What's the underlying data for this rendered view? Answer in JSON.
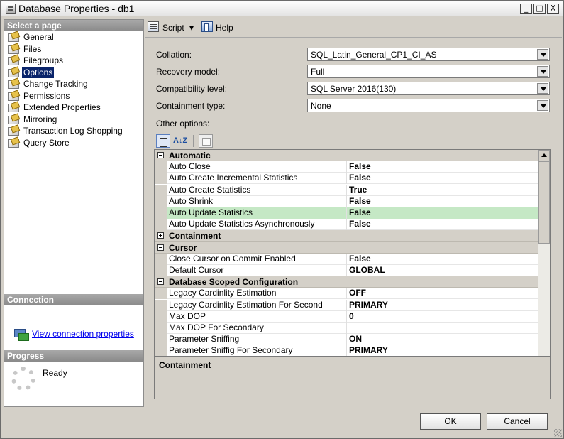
{
  "window": {
    "title": "Database Properties - db1",
    "controls": {
      "minimize": "_",
      "maximize": "□",
      "close": "X"
    }
  },
  "sidebar": {
    "select_page_header": "Select a page",
    "items": [
      {
        "label": "General"
      },
      {
        "label": "Files"
      },
      {
        "label": "Filegroups"
      },
      {
        "label": "Options",
        "selected": true
      },
      {
        "label": "Change Tracking"
      },
      {
        "label": "Permissions"
      },
      {
        "label": "Extended Properties"
      },
      {
        "label": "Mirroring"
      },
      {
        "label": "Transaction Log Shopping"
      },
      {
        "label": "Query Store"
      }
    ],
    "connection_header": "Connection",
    "connection_link": "View connection properties",
    "progress_header": "Progress",
    "progress_status": "Ready"
  },
  "toolbar": {
    "script_label": "Script",
    "script_arrow": "▾",
    "help_label": "Help"
  },
  "fields": {
    "collation": {
      "label": "Collation:",
      "value": "SQL_Latin_General_CP1_CI_AS"
    },
    "recovery_model": {
      "label": "Recovery model:",
      "value": "Full"
    },
    "compatibility_level": {
      "label": "Compatibility level:",
      "value": "SQL Server 2016(130)"
    },
    "containment_type": {
      "label": "Containment type:",
      "value": "None"
    },
    "other_options_label": "Other options:"
  },
  "grid_tools": {
    "alpha_label": "A↓Z"
  },
  "grid": {
    "categories": [
      {
        "label": "Automatic",
        "expanded": true,
        "rows": [
          {
            "name": "Auto Close",
            "value": "False"
          },
          {
            "name": "Auto Create Incremental Statistics",
            "value": "False"
          },
          {
            "name": "Auto Create Statistics",
            "value": "True"
          },
          {
            "name": "Auto Shrink",
            "value": "False"
          },
          {
            "name": "Auto Update Statistics",
            "value": "False",
            "highlighted": true
          },
          {
            "name": "Auto Update Statistics Asynchronously",
            "value": "False"
          }
        ]
      },
      {
        "label": "Containment",
        "expanded": false,
        "rows": []
      },
      {
        "label": "Cursor",
        "expanded": true,
        "rows": [
          {
            "name": "Close Cursor on Commit Enabled",
            "value": "False"
          },
          {
            "name": "Default Cursor",
            "value": "GLOBAL"
          }
        ]
      },
      {
        "label": "Database Scoped Configuration",
        "expanded": true,
        "rows": [
          {
            "name": "Legacy Cardinlity Estimation",
            "value": "OFF"
          },
          {
            "name": "Legacy Cardinlity Estimation For Second",
            "value": "PRIMARY"
          },
          {
            "name": "Max DOP",
            "value": "0"
          },
          {
            "name": "Max DOP For Secondary",
            "value": ""
          },
          {
            "name": "Parameter Sniffing",
            "value": "ON"
          },
          {
            "name": "Parameter Sniffig For Secondary",
            "value": "PRIMARY"
          }
        ]
      }
    ],
    "highlight_color": "#c5e8c5"
  },
  "description": {
    "title": "Containment"
  },
  "buttons": {
    "ok": "OK",
    "cancel": "Cancel"
  }
}
